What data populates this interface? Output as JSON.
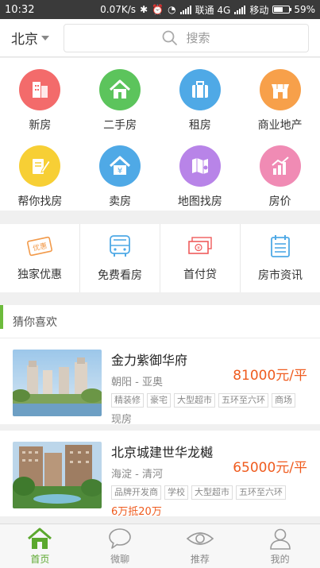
{
  "status_bar": {
    "time": "10:32",
    "speed": "0.07K/s",
    "carrier1": "联通 4G",
    "carrier2": "移动",
    "battery": "59%",
    "battery_level": 0.59
  },
  "header": {
    "city": "北京",
    "search_placeholder": "搜索"
  },
  "categories": [
    {
      "label": "新房",
      "icon": "building-icon",
      "color": "#f36b6b"
    },
    {
      "label": "二手房",
      "icon": "house-icon",
      "color": "#5cc45c"
    },
    {
      "label": "租房",
      "icon": "suitcase-icon",
      "color": "#4fa9e6"
    },
    {
      "label": "商业地产",
      "icon": "shop-icon",
      "color": "#f7a04a"
    },
    {
      "label": "帮你找房",
      "icon": "note-pencil-icon",
      "color": "#f7cf35"
    },
    {
      "label": "卖房",
      "icon": "yuan-house-icon",
      "color": "#4fa9e6"
    },
    {
      "label": "地图找房",
      "icon": "map-icon",
      "color": "#b884e8"
    },
    {
      "label": "房价",
      "icon": "chart-icon",
      "color": "#f08bb4"
    }
  ],
  "services": [
    {
      "label": "独家优惠",
      "icon": "coupon-icon",
      "icon_text": "优惠",
      "color": "#f29a4a"
    },
    {
      "label": "免费看房",
      "icon": "bus-icon",
      "color": "#4fa9e6"
    },
    {
      "label": "首付贷",
      "icon": "money-icon",
      "color": "#ef5b5b"
    },
    {
      "label": "房市资讯",
      "icon": "news-icon",
      "color": "#4fa9e6"
    }
  ],
  "recommend": {
    "title": "猜你喜欢",
    "items": [
      {
        "name": "金力紫御华府",
        "area": "朝阳 - 亚奥",
        "price": "81000元/平",
        "tags": [
          "精装修",
          "豪宅",
          "大型超市",
          "五环至六环",
          "商场"
        ],
        "extra": "现房",
        "promo": ""
      },
      {
        "name": "北京城建世华龙樾",
        "area": "海淀 - 清河",
        "price": "65000元/平",
        "tags": [
          "品牌开发商",
          "学校",
          "大型超市",
          "五环至六环"
        ],
        "extra": "",
        "promo": "6万抵20万"
      }
    ]
  },
  "tabbar": {
    "tabs": [
      {
        "label": "首页",
        "icon": "home-icon",
        "active": true
      },
      {
        "label": "微聊",
        "icon": "chat-icon",
        "active": false
      },
      {
        "label": "推荐",
        "icon": "eye-icon",
        "active": false
      },
      {
        "label": "我的",
        "icon": "user-icon",
        "active": false
      }
    ],
    "active_color": "#5ba82e"
  }
}
